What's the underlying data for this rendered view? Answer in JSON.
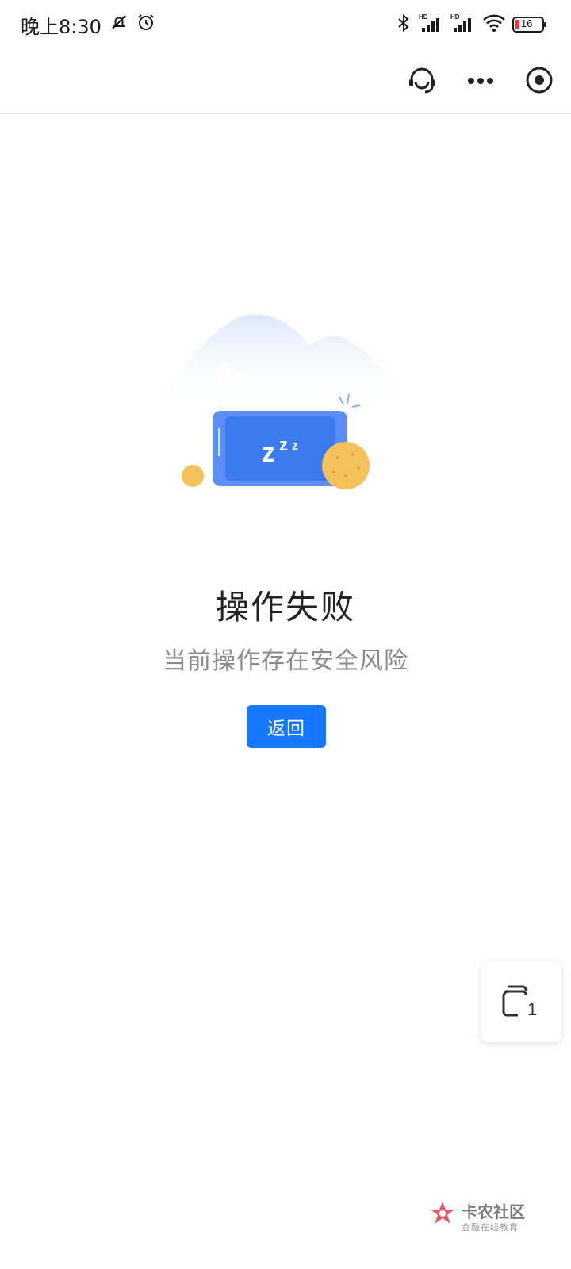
{
  "status_bar": {
    "time": "晚上8:30",
    "battery": "16",
    "icons": [
      "mute-bell-icon",
      "alarm-icon",
      "bluetooth-icon",
      "signal-hd-icon",
      "signal-hd-icon",
      "wifi-icon",
      "battery-icon"
    ]
  },
  "nav": {
    "icons": [
      "customer-service-icon",
      "more-icon",
      "close-target-icon"
    ]
  },
  "main": {
    "title": "操作失败",
    "subtitle": "当前操作存在安全风险",
    "back_label": "返回",
    "illustration_text": "zzz"
  },
  "float_widget": {
    "count": "1",
    "icon": "stacked-pages-icon"
  },
  "watermark": {
    "main": "卡农社区",
    "sub": "金融在线教育"
  },
  "colors": {
    "accent": "#1677ff",
    "phone_blue": "#3d7af0",
    "coin_yellow": "#f5c15b"
  }
}
